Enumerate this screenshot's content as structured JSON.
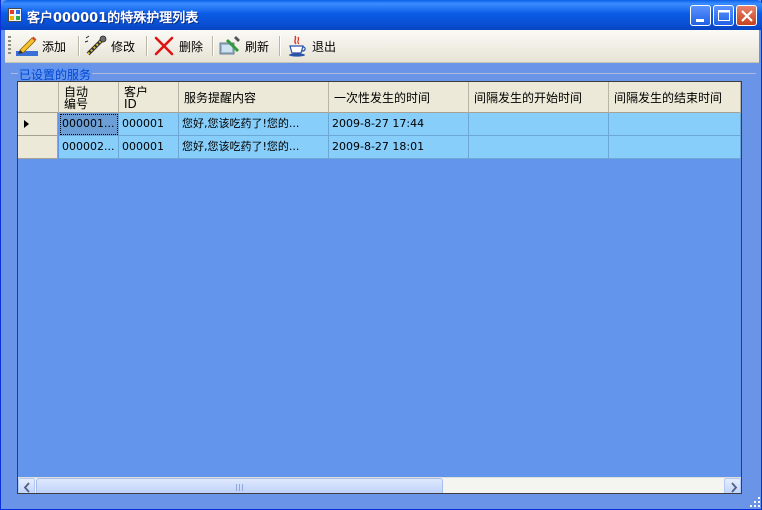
{
  "window": {
    "title": "客户000001的特殊护理列表"
  },
  "toolbar": {
    "add_label": "添加",
    "edit_label": "修改",
    "delete_label": "删除",
    "refresh_label": "刷新",
    "exit_label": "退出"
  },
  "group": {
    "label": "已设置的服务"
  },
  "grid": {
    "columns": [
      {
        "line1": "自动",
        "line2": "编号"
      },
      {
        "line1": "客户",
        "line2": "ID"
      },
      {
        "line1": "服务提醒内容",
        "line2": ""
      },
      {
        "line1": "一次性发生的时间",
        "line2": ""
      },
      {
        "line1": "间隔发生的开始时间",
        "line2": ""
      },
      {
        "line1": "间隔发生的结束时间",
        "line2": ""
      }
    ],
    "rows": [
      {
        "auto_id": "000001...",
        "customer_id": "000001",
        "content": "您好,您该吃药了!您的...",
        "once_time": "2009-8-27 17:44",
        "interval_start": "",
        "interval_end": ""
      },
      {
        "auto_id": "000002...",
        "customer_id": "000001",
        "content": "您好,您该吃药了!您的...",
        "once_time": "2009-8-27 18:01",
        "interval_start": "",
        "interval_end": ""
      }
    ],
    "current_row_index": 0
  },
  "colors": {
    "background": "#6495ed",
    "row": "#87cefa",
    "header": "#ece9d8",
    "group_label": "#0046d5"
  }
}
